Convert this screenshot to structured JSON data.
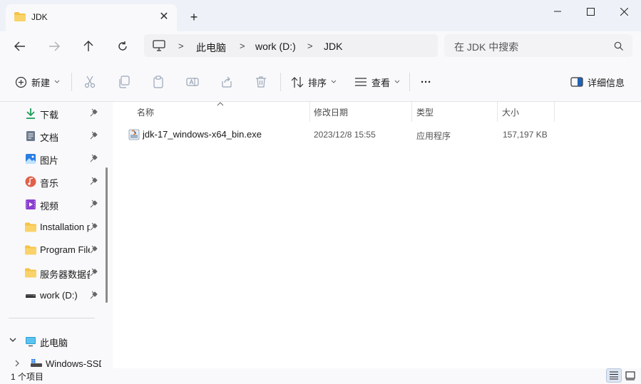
{
  "window": {
    "tab_title": "JDK",
    "new_tab": "+",
    "close_tab": "✕"
  },
  "address": {
    "crumbs": [
      "此电脑",
      "work (D:)",
      "JDK"
    ],
    "separator": ">",
    "search_placeholder": "在 JDK 中搜索"
  },
  "toolbar": {
    "new_label": "新建",
    "sort_label": "排序",
    "view_label": "查看",
    "more_label": "···",
    "details_label": "详细信息"
  },
  "sidebar": {
    "items": [
      {
        "label": "下载",
        "icon": "download-icon"
      },
      {
        "label": "文档",
        "icon": "document-icon"
      },
      {
        "label": "图片",
        "icon": "picture-icon"
      },
      {
        "label": "音乐",
        "icon": "music-icon"
      },
      {
        "label": "视频",
        "icon": "video-icon"
      },
      {
        "label": "Installation p",
        "icon": "folder-icon"
      },
      {
        "label": "Program File",
        "icon": "folder-icon"
      },
      {
        "label": "服务器数据备",
        "icon": "folder-icon"
      },
      {
        "label": "work (D:)",
        "icon": "drive-icon"
      }
    ],
    "this_pc": "此电脑",
    "windows_ssd": "Windows-SSD"
  },
  "columns": {
    "name": "名称",
    "modified": "修改日期",
    "type": "类型",
    "size": "大小"
  },
  "files": [
    {
      "name": "jdk-17_windows-x64_bin.exe",
      "modified": "2023/12/8 15:55",
      "type": "应用程序",
      "size": "157,197 KB"
    }
  ],
  "status": {
    "item_count": "1 个项目"
  },
  "colors": {
    "accent": "#0067c0",
    "folder": "#f5c345"
  }
}
